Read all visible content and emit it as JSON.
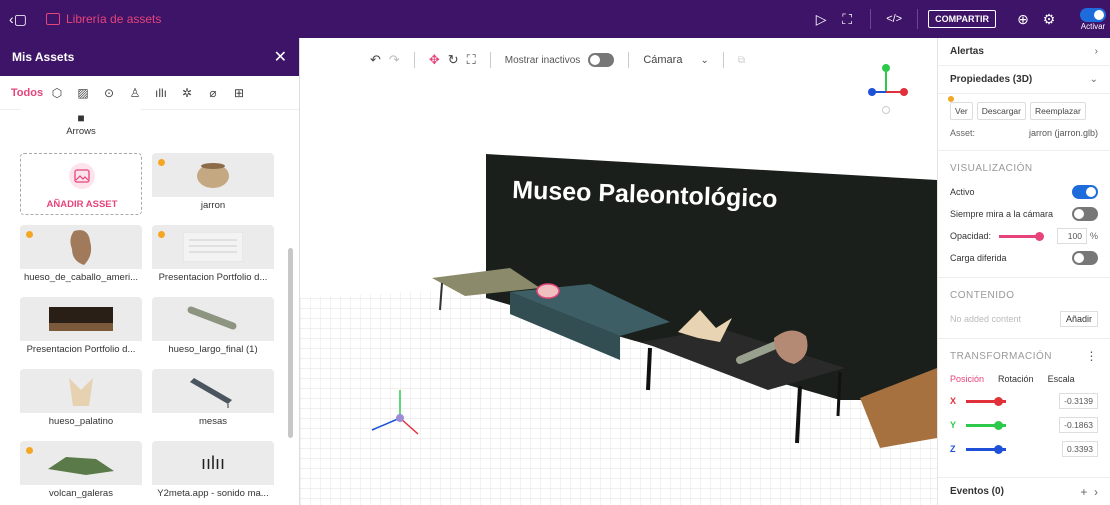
{
  "topbar": {
    "title": "Librería de assets",
    "share_label": "COMPARTIR",
    "activate_label": "Activar"
  },
  "left_panel": {
    "title": "Mis Assets",
    "filter_all": "Todos",
    "folder_label": "Arrows",
    "add_label": "AÑADIR ASSET",
    "assets": [
      {
        "label": "jarron"
      },
      {
        "label": "hueso_de_caballo_ameri..."
      },
      {
        "label": "Presentacion Portfolio d..."
      },
      {
        "label": "Presentacion Portfolio d..."
      },
      {
        "label": "hueso_largo_final (1)"
      },
      {
        "label": "hueso_palatino"
      },
      {
        "label": "mesas"
      },
      {
        "label": "volcan_galeras"
      },
      {
        "label": "Y2meta.app - sonido ma..."
      }
    ]
  },
  "viewport": {
    "show_inactive_label": "Mostrar inactivos",
    "camera_label": "Cámara",
    "scene_wall_text": "Museo Paleontológico"
  },
  "right_panel": {
    "alerts_label": "Alertas",
    "properties_label": "Propiedades (3D)",
    "btn_view": "Ver",
    "btn_download": "Descargar",
    "btn_replace": "Reemplazar",
    "asset_key": "Asset:",
    "asset_value": "jarron (jarron.glb)",
    "visual_header": "VISUALIZACIÓN",
    "active_label": "Activo",
    "look_camera_label": "Siempre mira a la cámara",
    "opacity_label": "Opacidad:",
    "opacity_value": "100",
    "opacity_unit": "%",
    "lazy_label": "Carga diferida",
    "content_header": "CONTENIDO",
    "no_content": "No added content",
    "add_label": "Añadir",
    "transform_header": "TRANSFORMACIÓN",
    "tab_position": "Posición",
    "tab_rotation": "Rotación",
    "tab_scale": "Escala",
    "x_label": "X",
    "x_value": "-0.3139",
    "y_label": "Y",
    "y_value": "-0.1863",
    "z_label": "Z",
    "z_value": "0.3393",
    "events_label": "Eventos (0)"
  }
}
